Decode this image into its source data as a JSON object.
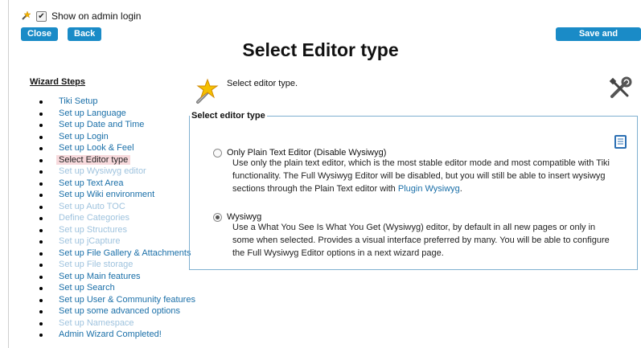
{
  "top": {
    "show_on_login_label": "Show on admin login",
    "show_on_login_checked": true
  },
  "buttons": {
    "close": "Close",
    "back": "Back",
    "save_continue": "Save and Continue"
  },
  "page_title": "Select Editor type",
  "sidebar": {
    "title": "Wizard Steps",
    "items": [
      {
        "label": "Tiki Setup",
        "state": "active"
      },
      {
        "label": "Set up Language",
        "state": "active"
      },
      {
        "label": "Set up Date and Time",
        "state": "active"
      },
      {
        "label": "Set up Login",
        "state": "active"
      },
      {
        "label": "Set up Look & Feel",
        "state": "active"
      },
      {
        "label": "Select Editor type",
        "state": "current"
      },
      {
        "label": "Set up Wysiwyg editor",
        "state": "disabled"
      },
      {
        "label": "Set up Text Area",
        "state": "active"
      },
      {
        "label": "Set up Wiki environment",
        "state": "active"
      },
      {
        "label": "Set up Auto TOC",
        "state": "disabled"
      },
      {
        "label": "Define Categories",
        "state": "disabled"
      },
      {
        "label": "Set up Structures",
        "state": "disabled"
      },
      {
        "label": "Set up jCapture",
        "state": "disabled"
      },
      {
        "label": "Set up File Gallery & Attachments",
        "state": "active"
      },
      {
        "label": "Set up File storage",
        "state": "disabled"
      },
      {
        "label": "Set up Main features",
        "state": "active"
      },
      {
        "label": "Set up Search",
        "state": "active"
      },
      {
        "label": "Set up User & Community features",
        "state": "active"
      },
      {
        "label": "Set up some advanced options",
        "state": "active"
      },
      {
        "label": "Set up Namespace",
        "state": "disabled"
      },
      {
        "label": "Admin Wizard Completed!",
        "state": "active"
      }
    ]
  },
  "main": {
    "intro": "Select editor type.",
    "fieldset_legend": "Select editor type",
    "options": [
      {
        "label": "Only Plain Text Editor (Disable Wysiwyg)",
        "checked": false,
        "desc_before": "Use only the plain text editor, which is the most stable editor mode and most compatible with Tiki functionality. The Full Wysiwyg Editor will be disabled, but you will still be able to insert wysiwyg sections through the Plain Text editor with ",
        "desc_link": "Plugin Wysiwyg",
        "desc_after": "."
      },
      {
        "label": "Wysiwyg",
        "checked": true,
        "desc": "Use a What You See Is What You Get (Wysiwyg) editor, by default in all new pages or only in some when selected. Provides a visual interface preferred by many. You will be able to configure the Full Wysiwyg Editor options in a next wizard page."
      }
    ]
  },
  "colors": {
    "button_bg": "#1a8bc7",
    "link": "#1a6fa8",
    "disabled_link": "#9fc3de",
    "current_highlight": "#f7d9dc",
    "fieldset_border": "#7fb0d0"
  },
  "icons": [
    "magic-wand-icon",
    "tools-icon",
    "help-book-icon"
  ]
}
